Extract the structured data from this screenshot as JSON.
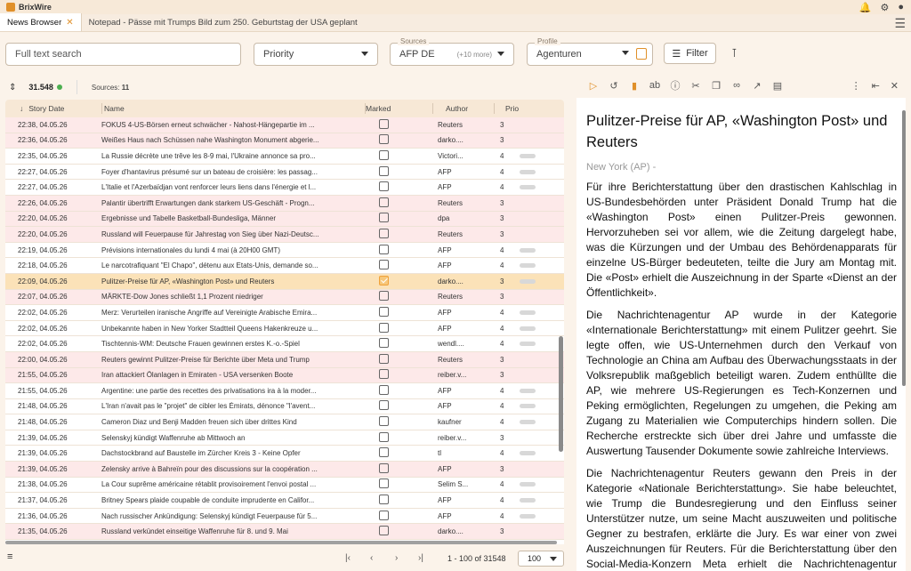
{
  "app": {
    "title": "BrixWire"
  },
  "tabs": [
    {
      "label": "News Browser",
      "active": true
    },
    {
      "label": "Notepad - Pässe mit Trumps Bild zum 250. Geburtstag der USA geplant",
      "active": false
    }
  ],
  "filters": {
    "search_placeholder": "Full text search",
    "priority_placeholder": "Priority",
    "sources_legend": "Sources",
    "sources_value": "AFP DE",
    "sources_more": "(+10 more)",
    "profile_legend": "Profile",
    "profile_value": "Agenturen",
    "filter_label": "Filter"
  },
  "stats": {
    "count": "31.548",
    "sources_label": "Sources:",
    "sources_count": "11"
  },
  "columns": {
    "date": "Story Date",
    "name": "Name",
    "marked": "Marked",
    "author": "Author",
    "prio": "Prio"
  },
  "rows": [
    {
      "date": "22:38, 04.05.26",
      "name": "FOKUS 4-US-Börsen erneut schwächer - Nahost-Hängepartie im ...",
      "author": "Reuters",
      "prio": "3",
      "pink": true,
      "marked": false,
      "pill": false
    },
    {
      "date": "22:36, 04.05.26",
      "name": "Weißes Haus nach Schüssen nahe Washington Monument abgerie...",
      "author": "darko....",
      "prio": "3",
      "pink": true,
      "marked": false,
      "pill": false
    },
    {
      "date": "22:35, 04.05.26",
      "name": "La Russie décrète une trêve les 8-9 mai, l'Ukraine annonce sa pro...",
      "author": "Victori...",
      "prio": "4",
      "pink": false,
      "marked": false,
      "pill": true
    },
    {
      "date": "22:27, 04.05.26",
      "name": "Foyer d'hantavirus présumé sur un bateau de croisière: les passag...",
      "author": "AFP",
      "prio": "4",
      "pink": false,
      "marked": false,
      "pill": true
    },
    {
      "date": "22:27, 04.05.26",
      "name": "L'Italie et l'Azerbaïdjan vont renforcer leurs liens dans l'énergie et l...",
      "author": "AFP",
      "prio": "4",
      "pink": false,
      "marked": false,
      "pill": true
    },
    {
      "date": "22:26, 04.05.26",
      "name": "Palantir übertrifft Erwartungen dank starkem US-Geschäft - Progn...",
      "author": "Reuters",
      "prio": "3",
      "pink": true,
      "marked": false,
      "pill": false
    },
    {
      "date": "22:20, 04.05.26",
      "name": "Ergebnisse und Tabelle Basketball-Bundesliga, Männer",
      "author": "dpa",
      "prio": "3",
      "pink": true,
      "marked": false,
      "pill": false
    },
    {
      "date": "22:20, 04.05.26",
      "name": "Russland will Feuerpause für Jahrestag von Sieg über Nazi-Deutsc...",
      "author": "Reuters",
      "prio": "3",
      "pink": true,
      "marked": false,
      "pill": false
    },
    {
      "date": "22:19, 04.05.26",
      "name": "Prévisions internationales du lundi 4 mai (à 20H00 GMT)",
      "author": "AFP",
      "prio": "4",
      "pink": false,
      "marked": false,
      "pill": true
    },
    {
      "date": "22:18, 04.05.26",
      "name": "Le narcotrafiquant \"El Chapo\", détenu aux Etats-Unis, demande so...",
      "author": "AFP",
      "prio": "4",
      "pink": false,
      "marked": false,
      "pill": true
    },
    {
      "date": "22:09, 04.05.26",
      "name": "Pulitzer-Preise für AP, «Washington Post» und Reuters",
      "author": "darko....",
      "prio": "3",
      "pink": false,
      "sel": true,
      "marked": true,
      "pill": true
    },
    {
      "date": "22:07, 04.05.26",
      "name": "MÄRKTE-Dow Jones schließt 1,1 Prozent niedriger",
      "author": "Reuters",
      "prio": "3",
      "pink": true,
      "marked": false,
      "pill": false
    },
    {
      "date": "22:02, 04.05.26",
      "name": "Merz: Verurteilen iranische Angriffe auf Vereinigte Arabische Emira...",
      "author": "AFP",
      "prio": "4",
      "pink": false,
      "marked": false,
      "pill": true
    },
    {
      "date": "22:02, 04.05.26",
      "name": "Unbekannte haben in New Yorker Stadtteil Queens Hakenkreuze u...",
      "author": "AFP",
      "prio": "4",
      "pink": false,
      "marked": false,
      "pill": true
    },
    {
      "date": "22:02, 04.05.26",
      "name": "Tischtennis-WM: Deutsche Frauen gewinnen erstes K.-o.-Spiel",
      "author": "wendl....",
      "prio": "4",
      "pink": false,
      "marked": false,
      "pill": true
    },
    {
      "date": "22:00, 04.05.26",
      "name": "Reuters gewinnt Pulitzer-Preise für Berichte über Meta und Trump",
      "author": "Reuters",
      "prio": "3",
      "pink": true,
      "marked": false,
      "pill": false
    },
    {
      "date": "21:55, 04.05.26",
      "name": "Iran attackiert Ölanlagen in Emiraten - USA versenken Boote",
      "author": "reiber.v...",
      "prio": "3",
      "pink": true,
      "marked": false,
      "pill": false
    },
    {
      "date": "21:55, 04.05.26",
      "name": "Argentine: une partie des recettes des privatisations ira à la moder...",
      "author": "AFP",
      "prio": "4",
      "pink": false,
      "marked": false,
      "pill": true
    },
    {
      "date": "21:48, 04.05.26",
      "name": "L'Iran n'avait pas le \"projet\" de cibler les Émirats, dénonce \"l'avent...",
      "author": "AFP",
      "prio": "4",
      "pink": false,
      "marked": false,
      "pill": true
    },
    {
      "date": "21:48, 04.05.26",
      "name": "Cameron Diaz und Benji Madden freuen sich über drittes Kind",
      "author": "kaufner",
      "prio": "4",
      "pink": false,
      "marked": false,
      "pill": true
    },
    {
      "date": "21:39, 04.05.26",
      "name": "Selenskyj kündigt Waffenruhe ab Mittwoch an",
      "author": "reiber.v...",
      "prio": "3",
      "pink": false,
      "marked": false,
      "pill": false
    },
    {
      "date": "21:39, 04.05.26",
      "name": "Dachstockbrand auf Baustelle im Zürcher Kreis 3 - Keine Opfer",
      "author": "tl",
      "prio": "4",
      "pink": false,
      "marked": false,
      "pill": true
    },
    {
      "date": "21:39, 04.05.26",
      "name": "Zelensky arrive à Bahreïn pour des discussions sur la coopération ...",
      "author": "AFP",
      "prio": "3",
      "pink": true,
      "marked": false,
      "pill": false
    },
    {
      "date": "21:38, 04.05.26",
      "name": "La Cour suprême américaine rétablit provisoirement l'envoi postal ...",
      "author": "Selim S...",
      "prio": "4",
      "pink": false,
      "marked": false,
      "pill": true
    },
    {
      "date": "21:37, 04.05.26",
      "name": "Britney Spears plaide coupable de conduite imprudente en Califor...",
      "author": "AFP",
      "prio": "4",
      "pink": false,
      "marked": false,
      "pill": true
    },
    {
      "date": "21:36, 04.05.26",
      "name": "Nach russischer Ankündigung: Selenskyj kündigt Feuerpause für 5...",
      "author": "AFP",
      "prio": "4",
      "pink": false,
      "marked": false,
      "pill": true
    },
    {
      "date": "21:35, 04.05.26",
      "name": "Russland verkündet einseitige Waffenruhe für 8. und 9. Mai",
      "author": "darko....",
      "prio": "3",
      "pink": true,
      "marked": false,
      "pill": false
    }
  ],
  "pager": {
    "range": "1 - 100 of 31548",
    "per_page": "100"
  },
  "article": {
    "headline": "Pulitzer-Preise für AP, «Washington Post» und Reuters",
    "dateline": "New York (AP) -",
    "paragraphs": [
      "Für ihre Berichterstattung über den drastischen Kahlschlag in US-Bundesbehörden unter Präsident Donald Trump hat die «Washington Post» einen Pulitzer-Preis gewonnen. Hervorzuheben sei vor allem, wie die Zeitung dargelegt habe, was die Kürzungen und der Umbau des Behördenapparats für einzelne US-Bürger bedeuteten, teilte die Jury am Montag mit. Die «Post» erhielt die Auszeichnung in der Sparte «Dienst an der Öffentlichkeit».",
      "Die Nachrichtenagentur AP wurde in der Kategorie «Internationale Berichterstattung» mit einem Pulitzer geehrt. Sie legte offen, wie US-Unternehmen durch den Verkauf von Technologie an China am Aufbau des Überwachungsstaats in der Volksrepublik maßgeblich beteiligt waren. Zudem enthüllte die AP, wie mehrere US-Regierungen es Tech-Konzernen und Peking ermöglichten, Regelungen zu umgehen, die Peking am Zugang zu Materialien wie Computerchips hindern sollen. Die Recherche erstreckte sich über drei Jahre und umfasste die Auswertung Tausender Dokumente sowie zahlreiche Interviews.",
      "Die Nachrichtenagentur Reuters gewann den Preis in der Kategorie «Nationale Berichterstattung». Sie habe beleuchtet, wie Trump die Bundesregierung und den Einfluss seiner Unterstützer nutze, um seine Macht auszuweiten und politische Gegner zu bestrafen, erklärte die Jury. Es war einer von zwei Auszeichnungen für Reuters. Für die Berichterstattung über den Social-Media-Konzern Meta erhielt die Nachrichtenagentur zudem einen Preis in der wiederholten Kategorie für"
    ]
  }
}
